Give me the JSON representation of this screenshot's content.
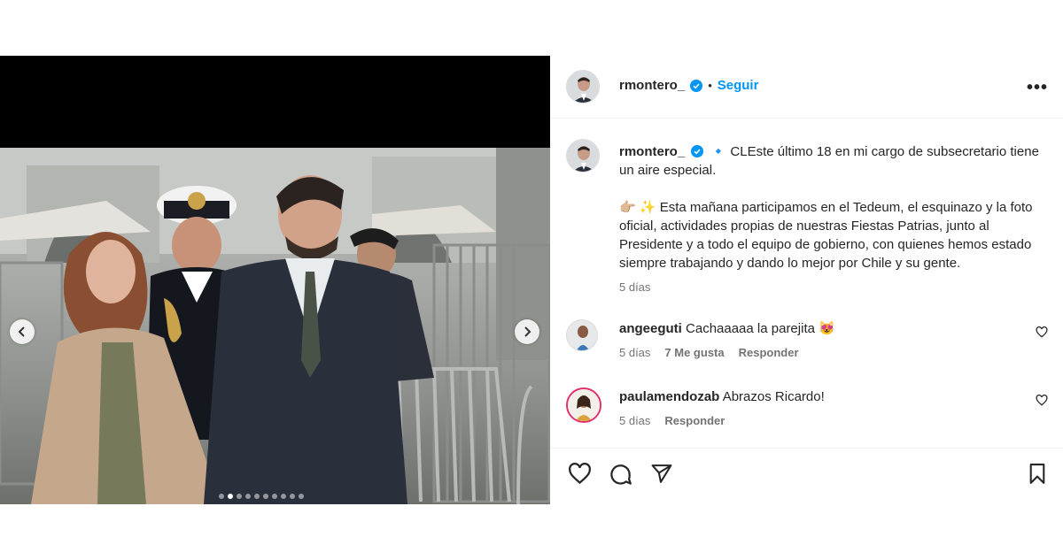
{
  "post": {
    "username": "rmontero_",
    "follow_label": "Seguir",
    "separator": "•",
    "more_label": "•••",
    "caption_prefix": "🔹 ",
    "caption_line1": "CLEste último 18 en mi cargo de subsecretario tiene un aire especial.",
    "caption_line2": "👉🏼 ✨ Esta mañana participamos en el Tedeum, el esquinazo y la foto oficial, actividades propias de nuestras Fiestas Patrias, junto al Presidente y a todo el equipo de gobierno, con quienes hemos estado siempre trabajando y dando lo mejor por Chile y su gente.",
    "caption_time": "5 días",
    "carousel": {
      "total": 10,
      "active": 1
    }
  },
  "comments": [
    {
      "username": "angeeguti",
      "text": "Cachaaaaa la parejita 😻",
      "time": "5 días",
      "likes": "7 Me gusta",
      "reply": "Responder"
    },
    {
      "username": "paulamendozab",
      "text": "Abrazos Ricardo!",
      "time": "5 días",
      "reply": "Responder"
    }
  ],
  "icons": {
    "verified": "verified-badge-icon",
    "like": "heart-icon",
    "comment": "comment-bubble-icon",
    "share": "paper-plane-icon",
    "save": "bookmark-icon",
    "prev": "chevron-left-icon",
    "next": "chevron-right-icon"
  },
  "colors": {
    "accent": "#0095f6",
    "verified": "#0095f6",
    "text": "#262626",
    "secondary": "#737373"
  }
}
